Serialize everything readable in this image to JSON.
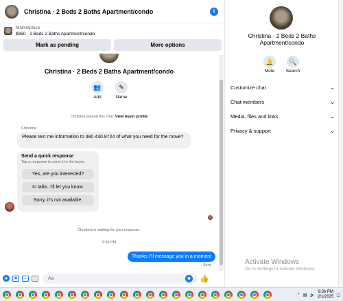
{
  "header": {
    "title": "Christina · 2 Beds 2 Baths Apartment/condo",
    "info_icon": "info-icon"
  },
  "marketplace": {
    "label": "Marketplace",
    "detail": "$850 - 2 Beds 2 Baths Apartment/condo"
  },
  "actions": {
    "pending_label": "Mark as pending",
    "more_label": "More options"
  },
  "thread": {
    "title": "Christina · 2 Beds 2 Baths Apartment/condo",
    "add_label": "Add",
    "name_label": "Name",
    "started_text": "Christina started this chat.",
    "view_profile_label": "View buyer profile",
    "sender_name": "Christina",
    "message_1": "Please text me information to 480.430.8724 of what you need for the move?",
    "quick_title": "Send a quick response",
    "quick_subtitle": "Tap a response to send it to the buyer.",
    "quick_options": [
      "Yes, are you interested?",
      "In talks. I'll let you know.",
      "Sorry, it's not available."
    ],
    "waiting_text": "Christina is waiting for your response.",
    "time": "9:36 PM",
    "reply": "Thanks i\"ll message you in a moment",
    "sent_label": "Sent"
  },
  "composer": {
    "placeholder": "Aa"
  },
  "panel": {
    "title": "Christina · 2 Beds 2 Baths Apartment/condo",
    "mute_label": "Mute",
    "search_label": "Search",
    "menu": [
      "Customize chat",
      "Chat members",
      "Media, files and links",
      "Privacy & support"
    ]
  },
  "watermark": {
    "title": "Activate Windows",
    "subtitle": "Go to Settings to activate Windows."
  },
  "taskbar": {
    "time": "9:36 PM",
    "date": "2/1/2025",
    "app_count": 21
  },
  "colors": {
    "accent": "#1877f2",
    "outgoing_bubble": "#0a7cff",
    "incoming_bubble": "#f0f0f0"
  }
}
